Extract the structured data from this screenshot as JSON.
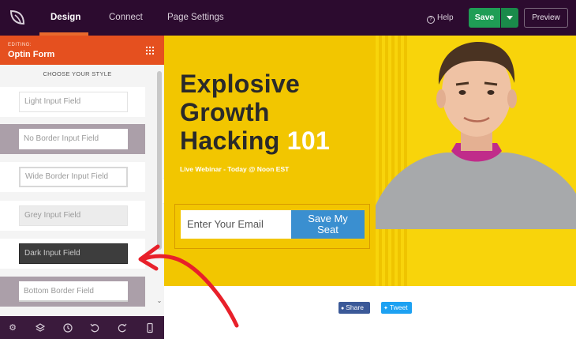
{
  "topbar": {
    "tabs": [
      {
        "label": "Design",
        "active": true
      },
      {
        "label": "Connect",
        "active": false
      },
      {
        "label": "Page Settings",
        "active": false
      }
    ],
    "help_label": "Help",
    "save_label": "Save",
    "preview_label": "Preview"
  },
  "sidebar": {
    "editing_label": "EDITING:",
    "editing_title": "Optin Form",
    "style_heading": "CHOOSE YOUR STYLE",
    "styles": [
      {
        "label": "Light Input Field"
      },
      {
        "label": "No Border Input Field"
      },
      {
        "label": "Wide Border Input Field"
      },
      {
        "label": "Grey Input Field"
      },
      {
        "label": "Dark Input Field"
      },
      {
        "label": "Bottom Border Field"
      }
    ]
  },
  "hero": {
    "headline_line1": "Explosive",
    "headline_line2": "Growth",
    "headline_line3": "Hacking",
    "headline_accent": "101",
    "subline": "Live Webinar - Today @ Noon EST",
    "email_placeholder": "Enter Your Email",
    "cta_line1": "Save My",
    "cta_line2": "Seat"
  },
  "social": {
    "share_label": "Share",
    "tweet_label": "Tweet"
  },
  "colors": {
    "topbar": "#2c0b2f",
    "accent_orange": "#e5501f",
    "save_green": "#1f9d55",
    "hero_yellow": "#f2c600",
    "cta_blue": "#3a8fd0",
    "annotation_red": "#e8202a"
  }
}
